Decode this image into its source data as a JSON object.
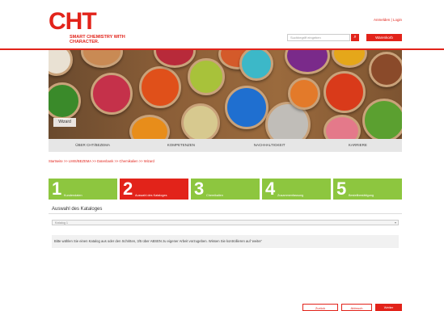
{
  "header": {
    "logo_text": "CHT",
    "logo_tagline": "SMART CHEMISTRY WITH CHARACTER.",
    "top_link": "Anmelden | Login",
    "search_placeholder": "Suchbegriff eingeben",
    "search_icon": "search-icon",
    "basket_label": "Warenkorb"
  },
  "banner": {
    "label": "Wizard"
  },
  "nav": {
    "items": [
      "Über CHT/Bezema",
      "Kompetenzen",
      "Nachhaltigkeit",
      "Karriere"
    ]
  },
  "breadcrumb": "Startseite >> LMIS/BEZEMA >> Datenbank >> Chemikalien >> Wizard",
  "steps": [
    {
      "num": "1",
      "label": "Kundendaten"
    },
    {
      "num": "2",
      "label": "Auswahl des Kataloges"
    },
    {
      "num": "3",
      "label": "Chemikalien"
    },
    {
      "num": "4",
      "label": "Zusammenfassung"
    },
    {
      "num": "5",
      "label": "Bestellbestätigung"
    }
  ],
  "active_step": 2,
  "catalogue": {
    "title": "Auswahl des Kataloges",
    "select_value": "Katalog 1",
    "info_text": "Bitte wählen Sie einen Katalog aus oder den Schritten, 3/5 über ABSEN zu eigener Arbeit vorzugeben. Wissen Sie kontrollieren auf 'weiter'"
  },
  "footer": {
    "back_label": "Zurück",
    "cancel_label": "Abbruch",
    "next_label": "Weiter"
  },
  "colors": {
    "brand_red": "#e2231a",
    "step_green": "#8dc63f"
  }
}
